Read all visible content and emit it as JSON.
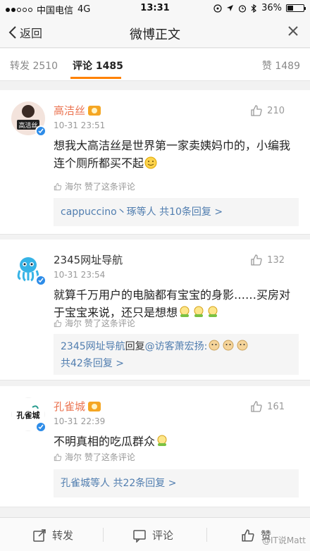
{
  "status_bar": {
    "carrier": "中国电信",
    "network": "4G",
    "time": "13:31",
    "battery": "36%",
    "battery_level": 0.36
  },
  "nav": {
    "back_label": "返回",
    "title": "微博正文"
  },
  "tabs": {
    "repost_label": "转发 2510",
    "comment_label": "评论 1485",
    "like_label": "赞 1489"
  },
  "comments": [
    {
      "username": "高洁丝",
      "avatar_text": "高洁丝",
      "time": "10-31 23:51",
      "likes": "210",
      "text": "想我大高洁丝是世界第一家卖姨妈巾的，小编我连个厕所都买不起",
      "liked_by": "海尔 赞了这条评论",
      "reply_summary": "cappuccino丶琢等人 共10条回复 >"
    },
    {
      "username": "2345网址导航",
      "time": "10-31 23:54",
      "likes": "132",
      "text": "就算千万用户的电脑都有宝宝的身影……买房对于宝宝来说，还只是想想",
      "liked_by": "海尔 赞了这条评论",
      "reply_name": "2345网址导航",
      "reply_mid": "回复",
      "reply_to": "@访客萧宏扬:",
      "reply_summary": "共42条回复 >"
    },
    {
      "username": "孔雀城",
      "avatar_text": "孔雀城",
      "time": "10-31 22:39",
      "likes": "161",
      "text": "不明真相的吃瓜群众",
      "liked_by": "海尔 赞了这条评论",
      "reply_summary": "孔雀城等人 共22条回复 >"
    }
  ],
  "toolbar": {
    "repost_label": "转发",
    "comment_label": "评论",
    "like_label": "赞"
  },
  "watermark": "@IT说Matt",
  "colors": {
    "accent": "#ff8200",
    "link": "#507daf",
    "vip_name": "#eb7350",
    "verified": "#2d8ce8"
  }
}
